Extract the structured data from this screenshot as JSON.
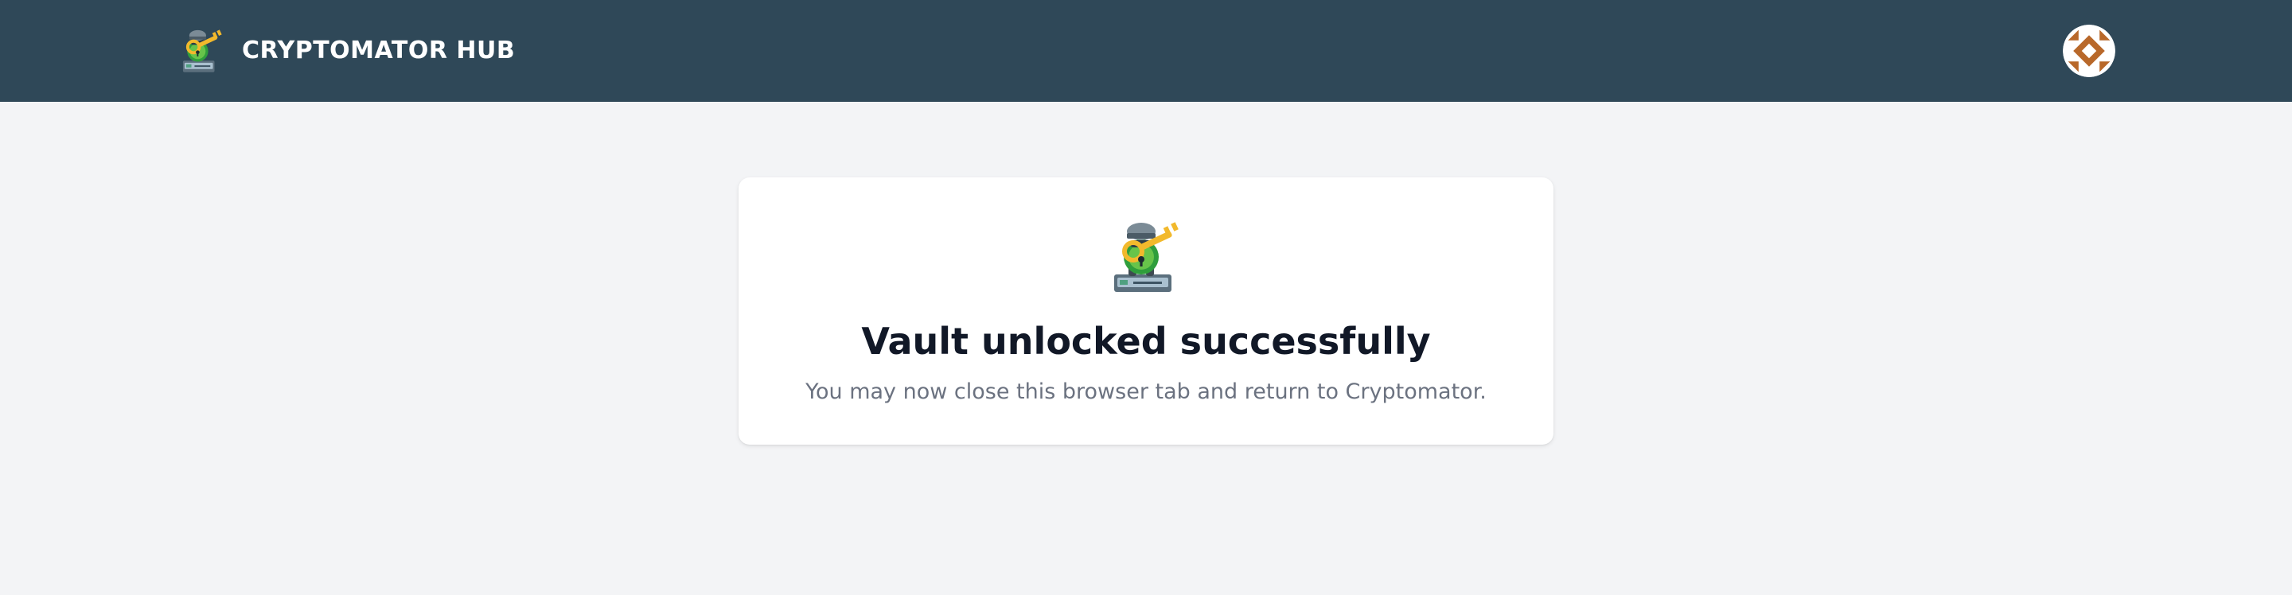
{
  "header": {
    "brand_name": "CRYPTOMATOR HUB",
    "logo_icon": "cryptomator-bot-logo-icon",
    "avatar_icon": "user-avatar-identicon",
    "bar_color": "#2f4858"
  },
  "main": {
    "card": {
      "icon": "cryptomator-bot-key-icon",
      "title": "Vault unlocked successfully",
      "message": "You may now close this browser tab and return to Cryptomator."
    }
  }
}
